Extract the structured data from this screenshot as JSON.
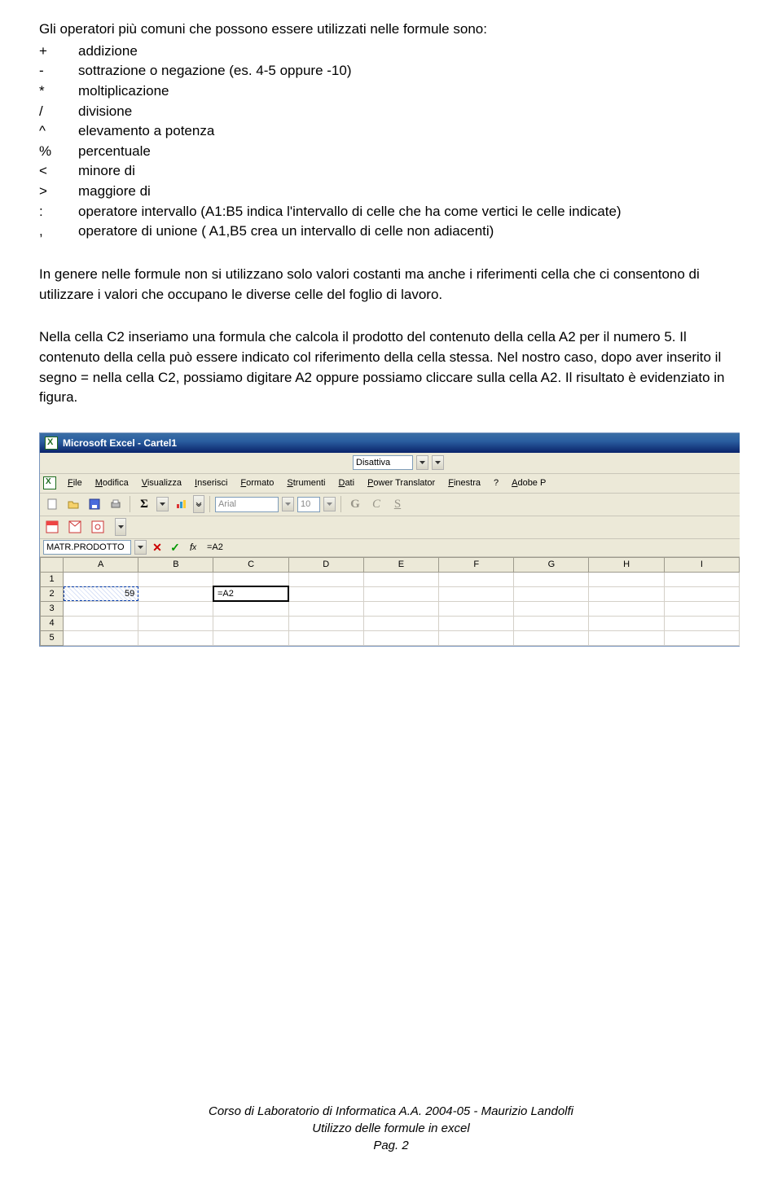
{
  "intro": "Gli operatori più comuni che possono essere utilizzati nelle formule sono:",
  "operators": [
    {
      "sym": "+",
      "desc": "addizione"
    },
    {
      "sym": "-",
      "desc": "sottrazione o negazione (es. 4-5 oppure -10)"
    },
    {
      "sym": "*",
      "desc": "moltiplicazione"
    },
    {
      "sym": "/",
      "desc": "divisione"
    },
    {
      "sym": "^",
      "desc": "elevamento a potenza"
    },
    {
      "sym": "%",
      "desc": "percentuale"
    },
    {
      "sym": "<",
      "desc": "minore di"
    },
    {
      "sym": ">",
      "desc": "maggiore di"
    },
    {
      "sym": ":",
      "desc": "operatore intervallo (A1:B5 indica l'intervallo di celle che ha come vertici le celle indicate)"
    },
    {
      "sym": ",",
      "desc": "operatore di unione ( A1,B5 crea un intervallo di celle non adiacenti)"
    }
  ],
  "para1": "In genere nelle formule non si utilizzano solo valori costanti ma anche i riferimenti cella che ci consentono di utilizzare i valori che occupano le diverse celle del foglio di lavoro.",
  "para2": "Nella cella C2 inseriamo una formula che calcola il prodotto del contenuto della cella A2 per il numero 5. Il contenuto della cella può essere indicato col riferimento della cella stessa. Nel nostro caso, dopo aver inserito il segno = nella cella C2, possiamo digitare A2 oppure possiamo cliccare sulla cella A2. Il risultato è evidenziato in figura.",
  "excel": {
    "title": "Microsoft Excel - Cartel1",
    "disattiva": "Disattiva",
    "menus": [
      "File",
      "Modifica",
      "Visualizza",
      "Inserisci",
      "Formato",
      "Strumenti",
      "Dati",
      "Power Translator",
      "Finestra",
      "?",
      "Adobe P"
    ],
    "font_name": "Arial",
    "font_size": "10",
    "name_box": "MATR.PRODOTTO",
    "formula": "=A2",
    "cols": [
      "A",
      "B",
      "C",
      "D",
      "E",
      "F",
      "G",
      "H",
      "I"
    ],
    "rows": [
      "1",
      "2",
      "3",
      "4",
      "5"
    ],
    "a2": "59",
    "c2": "=A2",
    "sigma": "Σ"
  },
  "footer": {
    "line1": "Corso di Laboratorio di Informatica A.A. 2004-05 - Maurizio Landolfi",
    "line2": "Utilizzo delle formule in excel",
    "line3": "Pag. 2"
  }
}
